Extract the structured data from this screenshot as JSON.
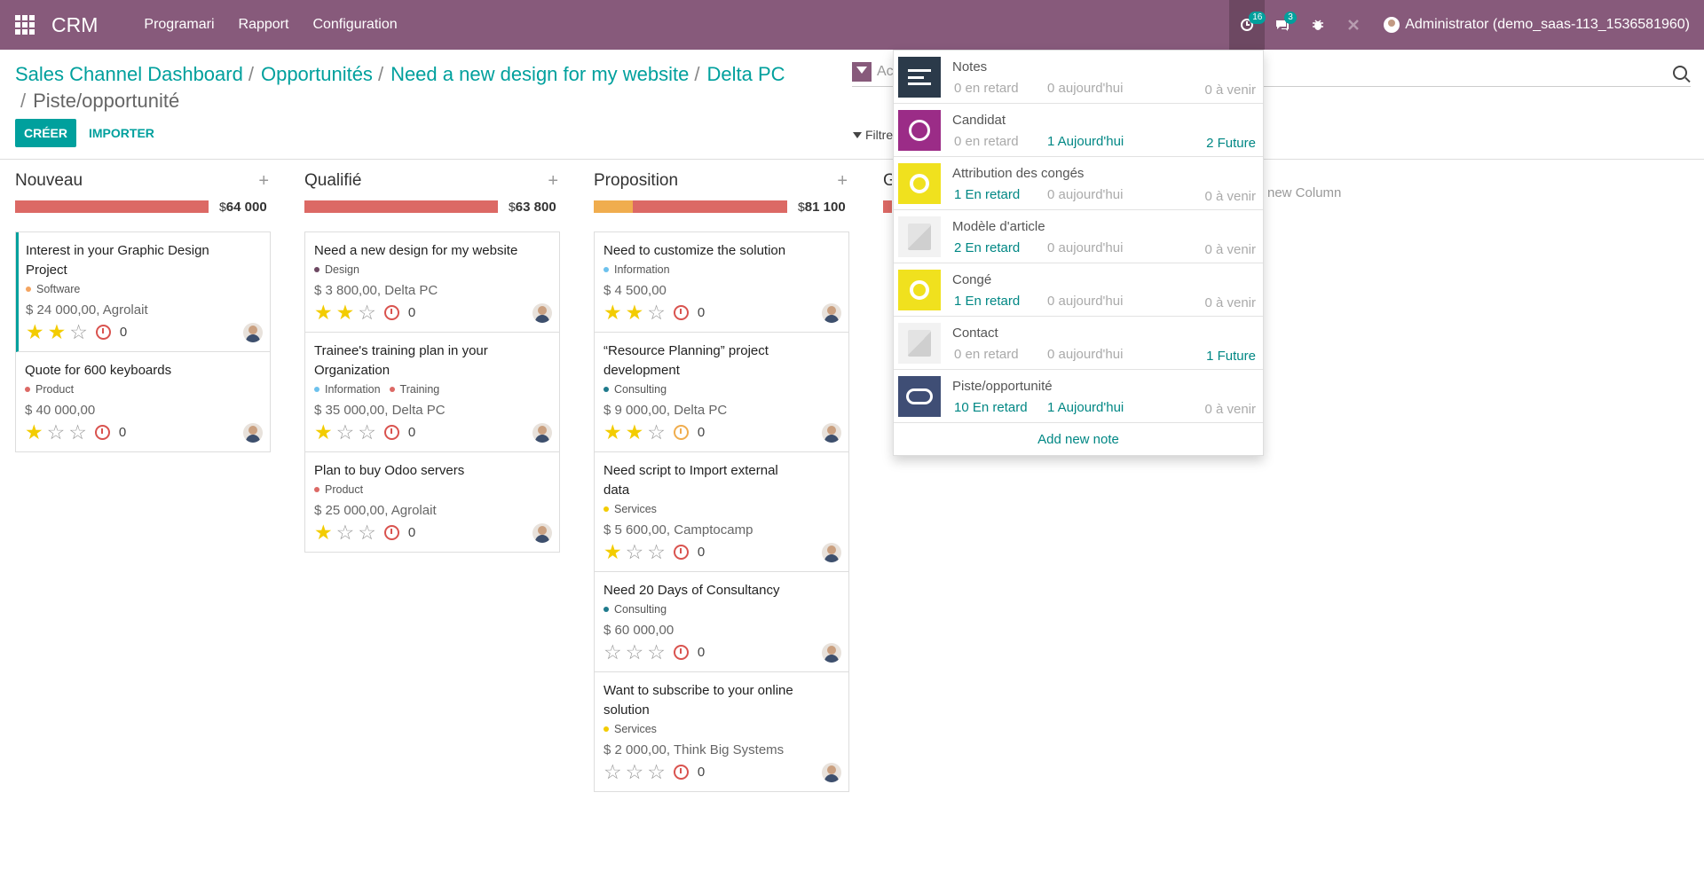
{
  "topbar": {
    "brand": "CRM",
    "menu": [
      "Programari",
      "Rapport",
      "Configuration"
    ],
    "activity_badge": "16",
    "messages_badge": "3",
    "user_name": "Administrator (demo_saas-113_1536581960)",
    "bg_color": "#875a7b"
  },
  "breadcrumb": {
    "items": [
      "Sales Channel Dashboard",
      "Opportunités",
      "Need a new design for my website",
      "Delta PC"
    ],
    "current": "Piste/opportunité",
    "sep": "/"
  },
  "buttons": {
    "create": "CRÉER",
    "import": "IMPORTER"
  },
  "search": {
    "placeholder": "Ac",
    "filters_label": "Filtre"
  },
  "kanban": {
    "add_column": "new Column",
    "columns": [
      {
        "title": "Nouveau",
        "total": "64 000",
        "currency": "$",
        "progress": [
          {
            "color": "#dc6965",
            "pct": 100
          }
        ],
        "cards": [
          {
            "title": "Interest in your Graphic Design Project",
            "tags": [
              {
                "name": "Software",
                "color": "#f4a460"
              }
            ],
            "amount": "$ 24 000,00, Agrolait",
            "stars": 2,
            "activity": "0",
            "clock": "red",
            "highlight": true
          },
          {
            "title": "Quote for 600 keyboards",
            "tags": [
              {
                "name": "Product",
                "color": "#dc6965"
              }
            ],
            "amount": "$ 40 000,00",
            "stars": 1,
            "activity": "0",
            "clock": "red",
            "highlight": false
          }
        ]
      },
      {
        "title": "Qualifié",
        "total": "63 800",
        "currency": "$",
        "progress": [
          {
            "color": "#dc6965",
            "pct": 100
          }
        ],
        "cards": [
          {
            "title": "Need a new design for my website",
            "tags": [
              {
                "name": "Design",
                "color": "#6d4862"
              }
            ],
            "amount": "$ 3 800,00, Delta PC",
            "stars": 2,
            "activity": "0",
            "clock": "red",
            "highlight": false
          },
          {
            "title": "Trainee's training plan in your Organization",
            "tags": [
              {
                "name": "Information",
                "color": "#6cc1ed"
              },
              {
                "name": "Training",
                "color": "#dc6965"
              }
            ],
            "amount": "$ 35 000,00, Delta PC",
            "stars": 1,
            "activity": "0",
            "clock": "red",
            "highlight": false
          },
          {
            "title": "Plan to buy Odoo servers",
            "tags": [
              {
                "name": "Product",
                "color": "#dc6965"
              }
            ],
            "amount": "$ 25 000,00, Agrolait",
            "stars": 1,
            "activity": "0",
            "clock": "red",
            "highlight": false
          }
        ]
      },
      {
        "title": "Proposition",
        "total": "81 100",
        "currency": "$",
        "progress": [
          {
            "color": "#f0ad4e",
            "pct": 20
          },
          {
            "color": "#dc6965",
            "pct": 80
          }
        ],
        "cards": [
          {
            "title": "Need to customize the solution",
            "tags": [
              {
                "name": "Information",
                "color": "#6cc1ed"
              }
            ],
            "amount": "$ 4 500,00",
            "stars": 2,
            "activity": "0",
            "clock": "red",
            "highlight": false
          },
          {
            "title": "“Resource Planning” project development",
            "tags": [
              {
                "name": "Consulting",
                "color": "#1f7a8c"
              }
            ],
            "amount": "$ 9 000,00, Delta PC",
            "stars": 2,
            "activity": "0",
            "clock": "warn",
            "highlight": false
          },
          {
            "title": "Need script to Import external data",
            "tags": [
              {
                "name": "Services",
                "color": "#f3cc00"
              }
            ],
            "amount": "$ 5 600,00, Camptocamp",
            "stars": 1,
            "activity": "0",
            "clock": "red",
            "highlight": false
          },
          {
            "title": "Need 20 Days of Consultancy",
            "tags": [
              {
                "name": "Consulting",
                "color": "#1f7a8c"
              }
            ],
            "amount": "$ 60 000,00",
            "stars": 0,
            "activity": "0",
            "clock": "red",
            "highlight": false
          },
          {
            "title": "Want to subscribe to your online solution",
            "tags": [
              {
                "name": "Services",
                "color": "#f3cc00"
              }
            ],
            "amount": "$ 2 000,00, Think Big Systems",
            "stars": 0,
            "activity": "0",
            "clock": "red",
            "highlight": false
          }
        ]
      },
      {
        "title": "G",
        "total": "",
        "currency": "",
        "progress": [
          {
            "color": "#dc6965",
            "pct": 100
          }
        ],
        "cards": []
      }
    ]
  },
  "activities": {
    "add_note": "Add new note",
    "items": [
      {
        "name": "Notes",
        "icon": "notes-icon",
        "late": "0 en retard",
        "late_on": false,
        "today": "0 aujourd'hui",
        "today_on": false,
        "future": "0 à venir",
        "future_on": false
      },
      {
        "name": "Candidat",
        "icon": "candidate-icon",
        "late": "0 en retard",
        "late_on": false,
        "today": "1 Aujourd'hui",
        "today_on": true,
        "future": "2 Future",
        "future_on": true
      },
      {
        "name": "Attribution des congés",
        "icon": "leave-allocation-icon",
        "late": "1 En retard",
        "late_on": true,
        "today": "0 aujourd'hui",
        "today_on": false,
        "future": "0 à venir",
        "future_on": false
      },
      {
        "name": "Modèle d'article",
        "icon": "product-template-icon",
        "late": "2 En retard",
        "late_on": true,
        "today": "0 aujourd'hui",
        "today_on": false,
        "future": "0 à venir",
        "future_on": false
      },
      {
        "name": "Congé",
        "icon": "leave-icon",
        "late": "1 En retard",
        "late_on": true,
        "today": "0 aujourd'hui",
        "today_on": false,
        "future": "0 à venir",
        "future_on": false
      },
      {
        "name": "Contact",
        "icon": "contact-icon",
        "late": "0 en retard",
        "late_on": false,
        "today": "0 aujourd'hui",
        "today_on": false,
        "future": "1 Future",
        "future_on": true
      },
      {
        "name": "Piste/opportunité",
        "icon": "lead-icon",
        "late": "10 En retard",
        "late_on": true,
        "today": "1 Aujourd'hui",
        "today_on": true,
        "future": "0 à venir",
        "future_on": false
      }
    ]
  }
}
